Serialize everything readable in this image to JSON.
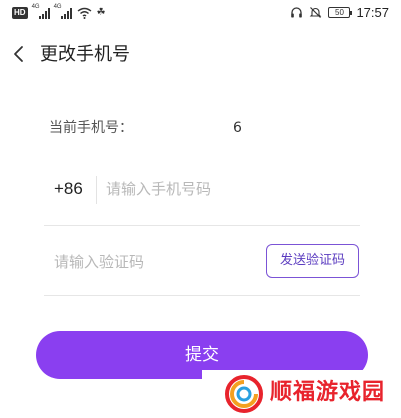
{
  "status_bar": {
    "hd_badge": "HD",
    "signal_tag": "4G",
    "battery": "50",
    "time": "17:57",
    "icons": [
      "hd-badge",
      "signal-4g-icon",
      "signal-4g-icon",
      "wifi-icon",
      "leaf-icon",
      "headset-icon",
      "mute-icon",
      "battery-icon"
    ]
  },
  "header": {
    "title": "更改手机号",
    "back_icon": "chevron-left-icon"
  },
  "current_phone": {
    "label": "当前手机号：",
    "value": "6"
  },
  "phone_input": {
    "country_code": "+86",
    "placeholder": "请输入手机号码",
    "value": ""
  },
  "code_input": {
    "placeholder": "请输入验证码",
    "value": ""
  },
  "send_code_label": "发送验证码",
  "submit_label": "提交",
  "watermark": {
    "text": "顺福游戏园"
  },
  "colors": {
    "accent": "#8a3ff0",
    "send_button_border": "#7b53d6",
    "watermark_red": "#e8232c"
  }
}
